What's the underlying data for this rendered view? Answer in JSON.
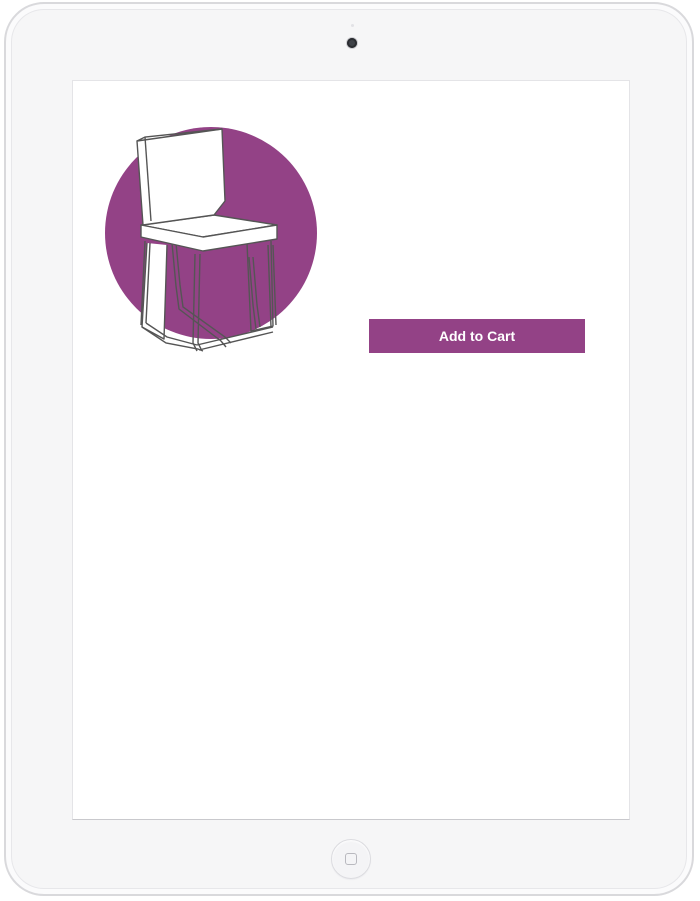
{
  "product": {
    "image_icon": "chair-illustration",
    "image_background_color": "#934286"
  },
  "actions": {
    "add_to_cart_label": "Add to Cart",
    "button_color": "#934286"
  },
  "device": {
    "home_icon": "home-button-icon",
    "camera_icon": "front-camera-icon"
  }
}
